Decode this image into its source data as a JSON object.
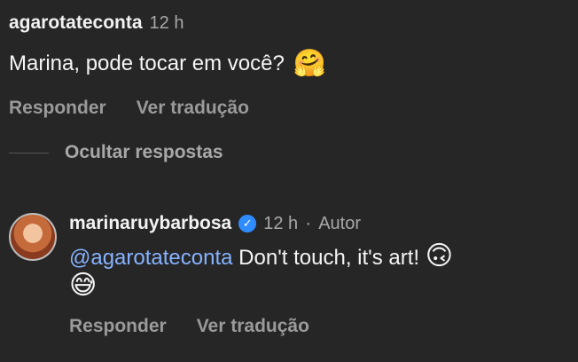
{
  "comment": {
    "username": "agarotateconta",
    "time": "12 h",
    "text": "Marina, pode tocar em você?",
    "emoji": "🤗",
    "actions": {
      "reply": "Responder",
      "translate": "Ver tradução"
    }
  },
  "hide_replies": {
    "label": "Ocultar respostas"
  },
  "reply": {
    "username": "marinaruybarbosa",
    "verified_icon": "verified-badge-icon",
    "time": "12 h",
    "separator": "·",
    "author_label": "Autor",
    "mention": "@agarotateconta",
    "text": " Don't touch, it's art! ",
    "emoji_1": "🙃",
    "emoji_2": "😅",
    "actions": {
      "reply": "Responder",
      "translate": "Ver tradução"
    }
  },
  "colors": {
    "background": "#262626",
    "mention": "#87b2ff",
    "verified": "#2f8cff",
    "muted": "#a8a8a8"
  }
}
